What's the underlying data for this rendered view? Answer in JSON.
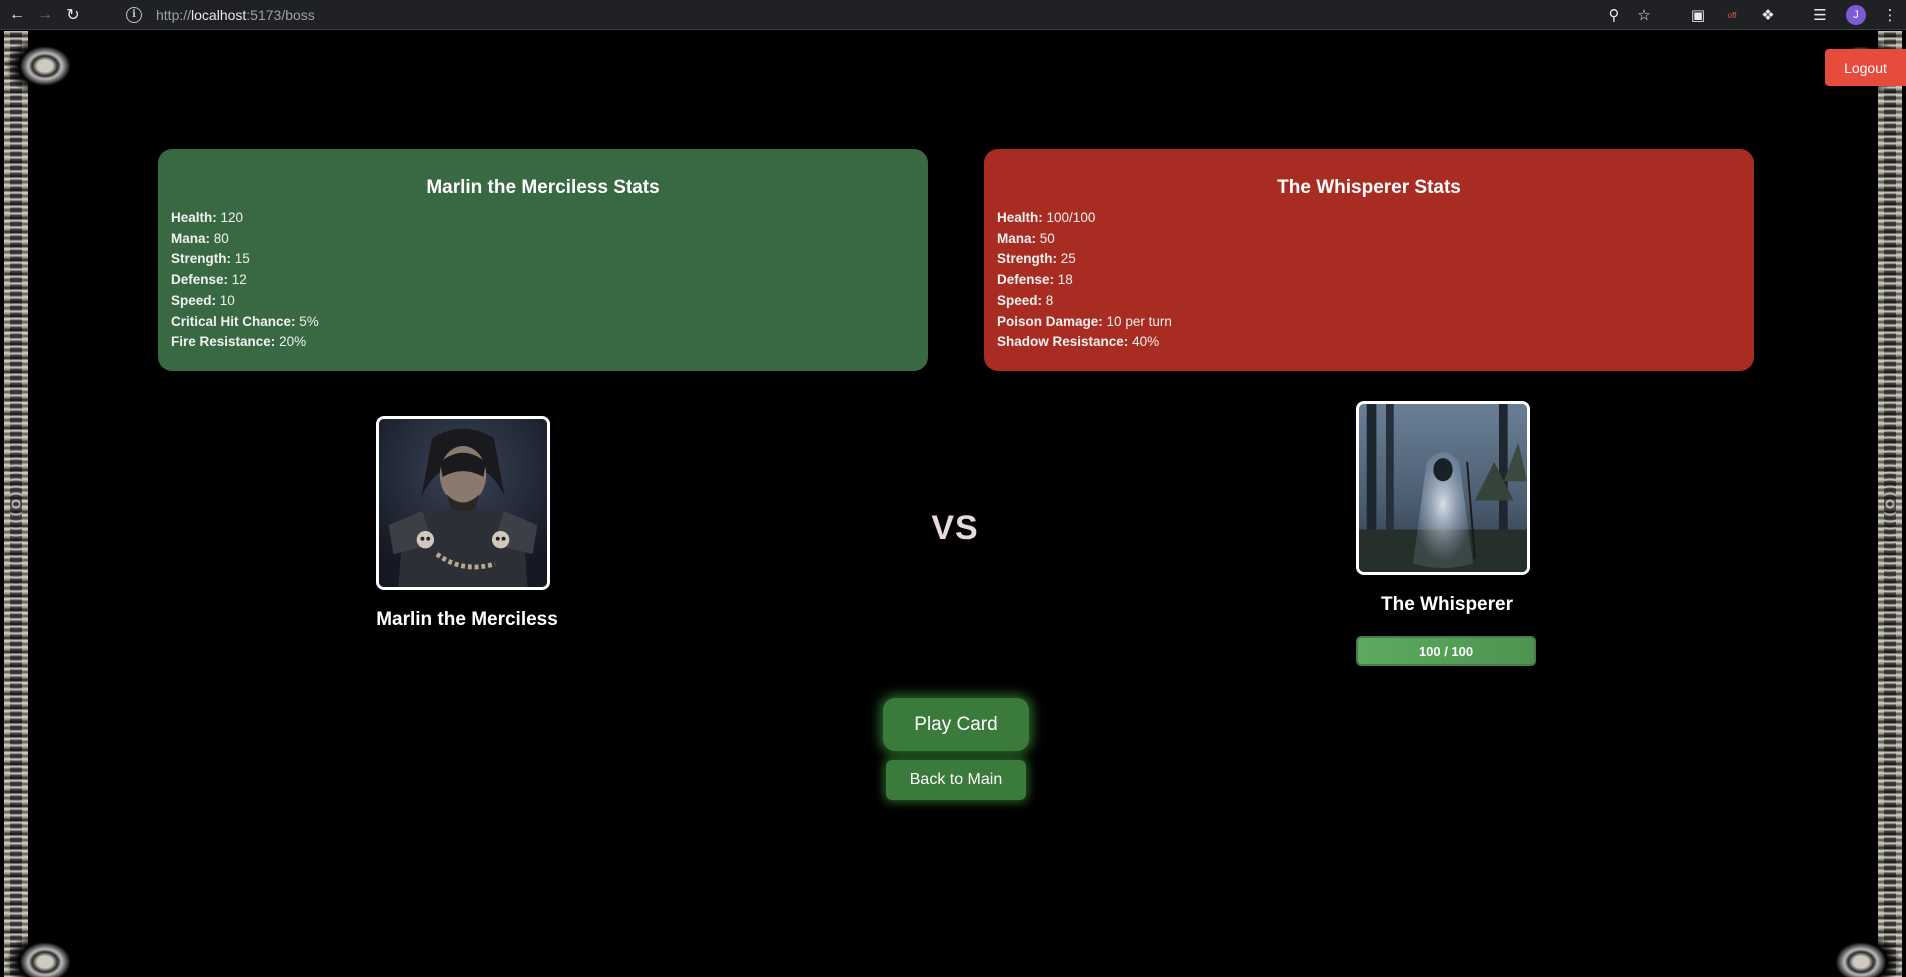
{
  "browser": {
    "url_scheme": "http://",
    "url_host": "localhost",
    "url_path": ":5173/boss",
    "profile_initial": "J",
    "extension_badge": "off"
  },
  "header": {
    "logout_label": "Logout"
  },
  "player": {
    "stats_title": "Marlin the Merciless Stats",
    "name": "Marlin the Merciless",
    "stats": [
      {
        "label": "Health:",
        "value": "120"
      },
      {
        "label": "Mana:",
        "value": "80"
      },
      {
        "label": "Strength:",
        "value": "15"
      },
      {
        "label": "Defense:",
        "value": "12"
      },
      {
        "label": "Speed:",
        "value": "10"
      },
      {
        "label": "Critical Hit Chance:",
        "value": "5%"
      },
      {
        "label": "Fire Resistance:",
        "value": "20%"
      }
    ]
  },
  "boss": {
    "stats_title": "The Whisperer Stats",
    "name": "The Whisperer",
    "health_text": "100 / 100",
    "health_fraction": 1.0,
    "stats": [
      {
        "label": "Health:",
        "value": "100/100"
      },
      {
        "label": "Mana:",
        "value": "50"
      },
      {
        "label": "Strength:",
        "value": "25"
      },
      {
        "label": "Defense:",
        "value": "18"
      },
      {
        "label": "Speed:",
        "value": "8"
      },
      {
        "label": "Poison Damage:",
        "value": "10 per turn"
      },
      {
        "label": "Shadow Resistance:",
        "value": "40%"
      }
    ]
  },
  "battle": {
    "vs_label": "VS",
    "play_card_label": "Play Card",
    "back_to_main_label": "Back to Main"
  },
  "colors": {
    "player_panel": "#386942",
    "boss_panel": "#a82c22",
    "logout": "#e64b3c",
    "button_green": "#3a7a3a"
  }
}
